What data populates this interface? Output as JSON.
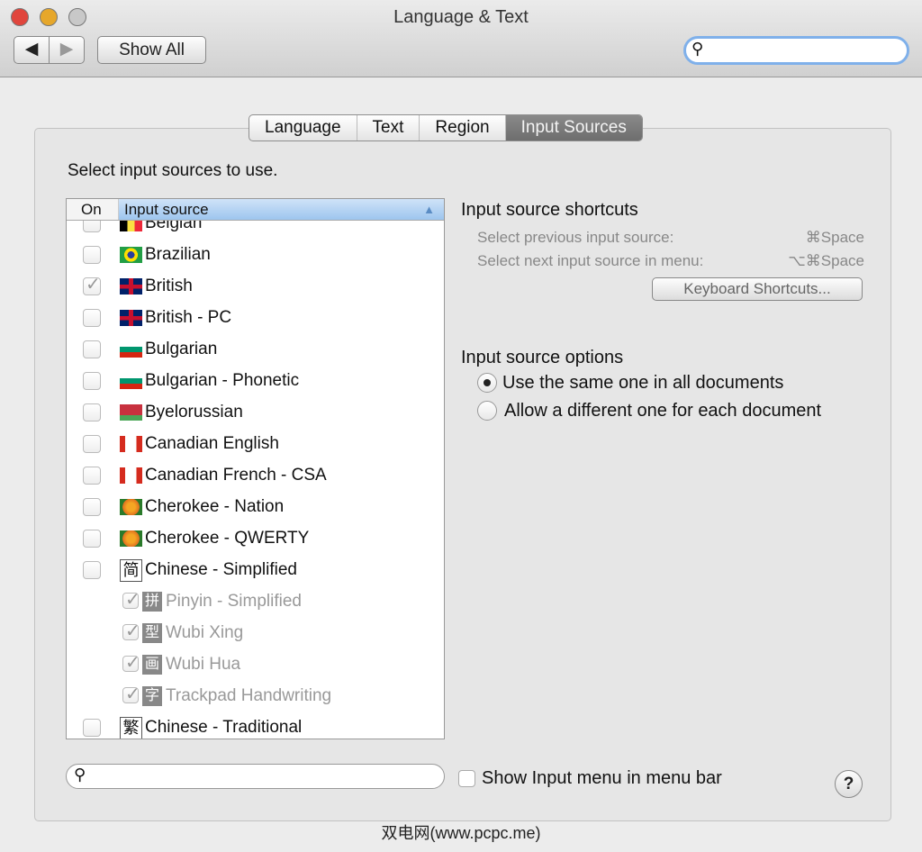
{
  "window": {
    "title": "Language & Text",
    "show_all": "Show All"
  },
  "tabs": [
    "Language",
    "Text",
    "Region",
    "Input Sources"
  ],
  "prompt": "Select input sources to use.",
  "list": {
    "col_on": "On",
    "col_source": "Input source",
    "items": [
      {
        "label": "Belgian",
        "checked": false,
        "sub": false
      },
      {
        "label": "Brazilian",
        "checked": false,
        "sub": false
      },
      {
        "label": "British",
        "checked": true,
        "sub": false
      },
      {
        "label": "British - PC",
        "checked": false,
        "sub": false
      },
      {
        "label": "Bulgarian",
        "checked": false,
        "sub": false
      },
      {
        "label": "Bulgarian - Phonetic",
        "checked": false,
        "sub": false
      },
      {
        "label": "Byelorussian",
        "checked": false,
        "sub": false
      },
      {
        "label": "Canadian English",
        "checked": false,
        "sub": false
      },
      {
        "label": "Canadian French - CSA",
        "checked": false,
        "sub": false
      },
      {
        "label": "Cherokee - Nation",
        "checked": false,
        "sub": false
      },
      {
        "label": "Cherokee - QWERTY",
        "checked": false,
        "sub": false
      },
      {
        "label": "Chinese - Simplified",
        "checked": false,
        "sub": false,
        "glyph": "简"
      },
      {
        "label": "Pinyin - Simplified",
        "checked": true,
        "sub": true,
        "glyph": "拼"
      },
      {
        "label": "Wubi Xing",
        "checked": true,
        "sub": true,
        "glyph": "型"
      },
      {
        "label": "Wubi Hua",
        "checked": true,
        "sub": true,
        "glyph": "画"
      },
      {
        "label": "Trackpad Handwriting",
        "checked": true,
        "sub": true,
        "glyph": "字"
      },
      {
        "label": "Chinese - Traditional",
        "checked": false,
        "sub": false,
        "glyph": "繁"
      }
    ]
  },
  "shortcuts": {
    "heading": "Input source shortcuts",
    "prev_label": "Select previous input source:",
    "prev_key": "⌘Space",
    "next_label": "Select next input source in menu:",
    "next_key": "⌥⌘Space",
    "button": "Keyboard Shortcuts..."
  },
  "options": {
    "heading": "Input source options",
    "same": "Use the same one in all documents",
    "different": "Allow a different one for each document",
    "selected": "same"
  },
  "show_menu": "Show Input menu in menu bar",
  "help": "?",
  "watermark": "双电网(www.pcpc.me)"
}
